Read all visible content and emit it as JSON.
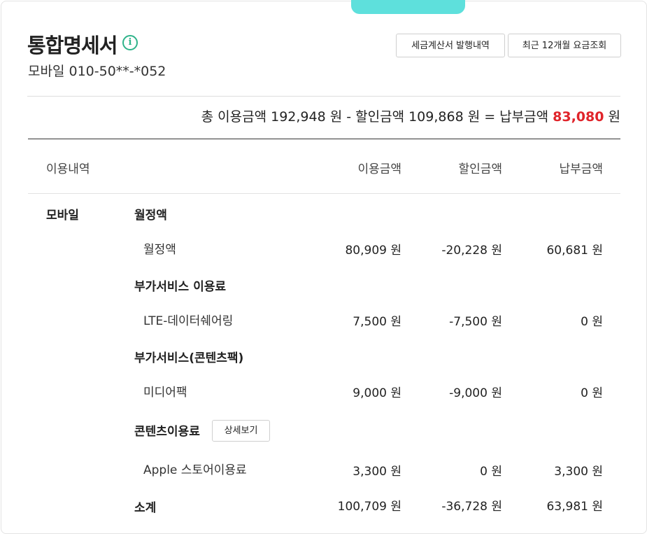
{
  "header": {
    "title": "통합명세서",
    "info_icon": "info-icon",
    "subtitle": "모바일 010-50**-*052",
    "btn_tax": "세금계산서 발행내역",
    "btn_recent": "최근 12개월 요금조회"
  },
  "summary": {
    "prefix": "총 이용금액 192,948 원 - 할인금액 109,868 원 = 납부금액 ",
    "amount": "83,080",
    "suffix": " 원"
  },
  "table": {
    "headers": [
      "이용내역",
      "이용금액",
      "할인금액",
      "납부금액"
    ],
    "category": "모바일",
    "detail_button": "상세보기",
    "groups": [
      {
        "title": "월정액",
        "item": "월정액",
        "values": [
          "80,909 원",
          "-20,228 원",
          "60,681 원"
        ]
      },
      {
        "title": "부가서비스 이용료",
        "item": "LTE-데이터쉐어링",
        "values": [
          "7,500 원",
          "-7,500 원",
          "0 원"
        ]
      },
      {
        "title": "부가서비스(콘텐츠팩)",
        "item": "미디어팩",
        "values": [
          "9,000 원",
          "-9,000 원",
          "0 원"
        ]
      },
      {
        "title": "콘텐츠이용료",
        "item": "Apple 스토어이용료",
        "values": [
          "3,300 원",
          "0 원",
          "3,300 원"
        ]
      }
    ],
    "subtotal": {
      "label": "소계",
      "values": [
        "100,709 원",
        "-36,728 원",
        "63,981 원"
      ]
    }
  },
  "colors": {
    "accent": "#5ee0dc",
    "highlight": "#e0242a",
    "info": "#2fb38a"
  }
}
